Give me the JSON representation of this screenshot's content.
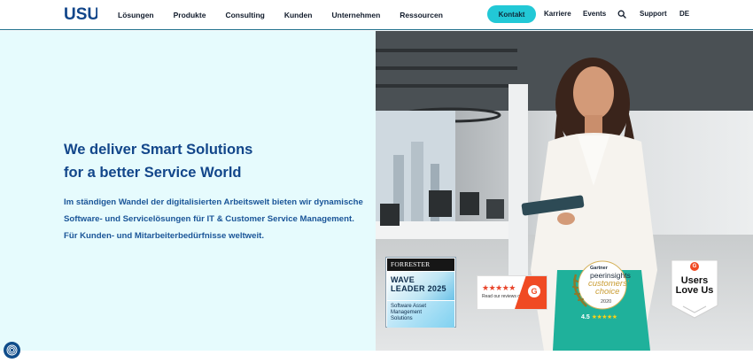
{
  "header": {
    "logo_text": "USU",
    "nav": [
      "Lösungen",
      "Produkte",
      "Consulting",
      "Kunden",
      "Unternehmen",
      "Ressourcen"
    ],
    "kontakt_label": "Kontakt",
    "karriere_label": "Karriere",
    "events_label": "Events",
    "support_label": "Support",
    "language_label": "DE"
  },
  "hero": {
    "headline_line1": "We deliver Smart Solutions",
    "headline_line2": "for a better Service World",
    "subtext_line1": "Im ständigen Wandel der digitalisierten Arbeitswelt bieten wir dynamische",
    "subtext_line2": "Software- und Servicelösungen für IT & Customer Service Management.",
    "subtext_line3": "Für Kunden- und Mitarbeiterbedürfnisse weltweit."
  },
  "badges": {
    "forrester": {
      "brand": "FORRESTER",
      "line1": "WAVE",
      "line2": "LEADER 2025",
      "category_line1": "Software Asset",
      "category_line2": "Management",
      "category_line3": "Solutions"
    },
    "g2_reviews": {
      "stars": "★★★★★",
      "text": "Read our reviews on",
      "logo": "G"
    },
    "gartner": {
      "brand": "Gartner",
      "product": "peerinsights",
      "choice_line1": "customers'",
      "choice_line2": "choice",
      "year": "2020",
      "rating": "4.5",
      "stars": "★★★★★"
    },
    "g2_users": {
      "logo": "G",
      "line1": "Users",
      "line2": "Love Us"
    }
  },
  "colors": {
    "brand_blue": "#12468a",
    "accent_cyan": "#22c8d6",
    "hero_bg": "#e6fbfd"
  },
  "icons": [
    "search-icon",
    "fingerprint-icon"
  ]
}
